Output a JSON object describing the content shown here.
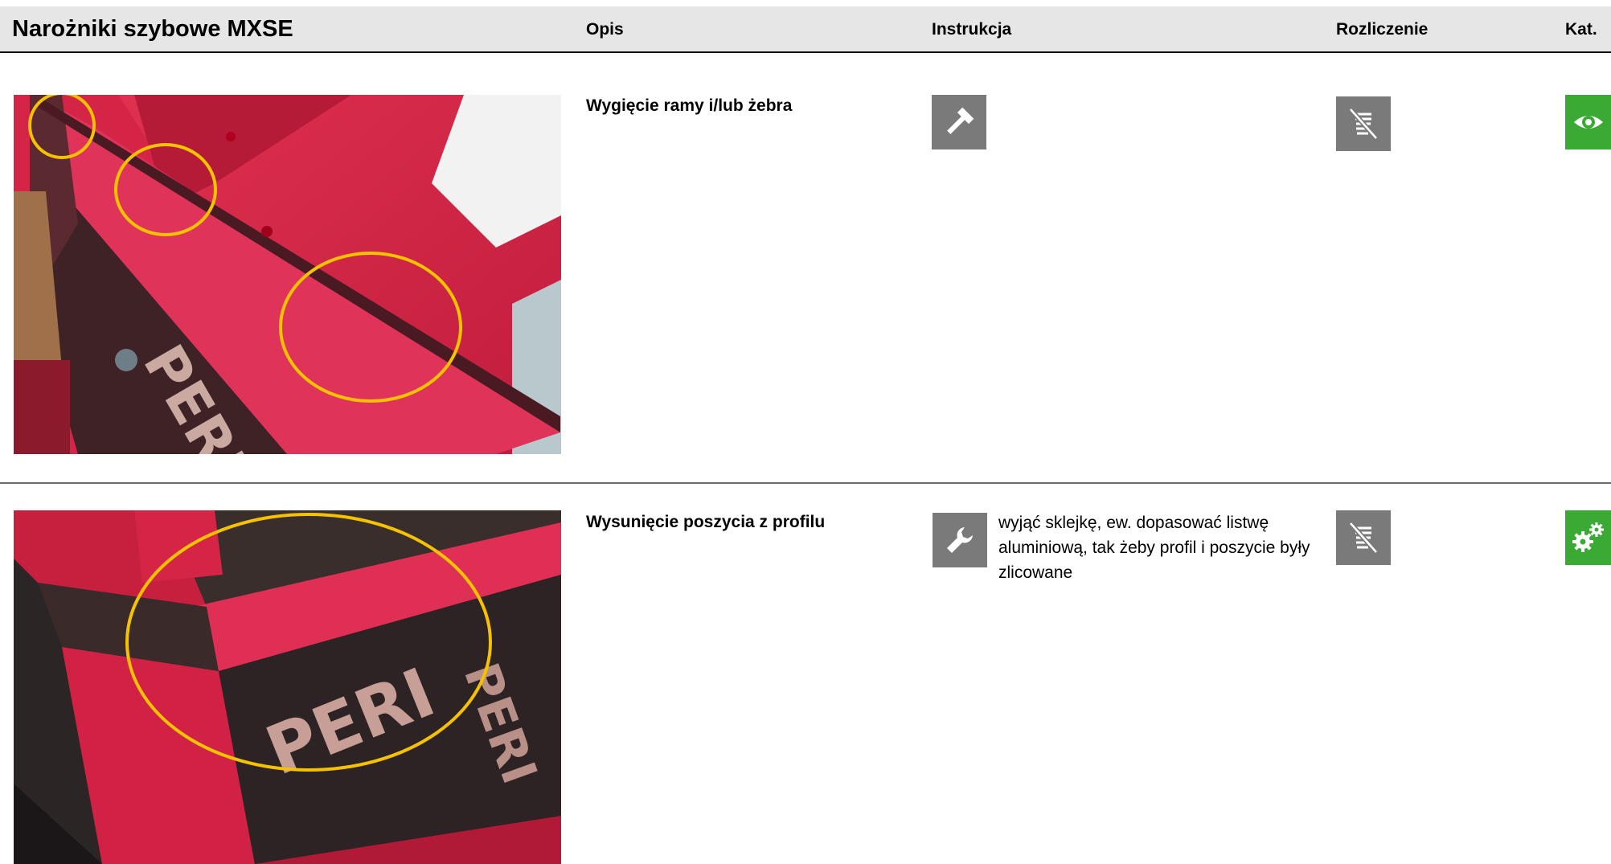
{
  "header": {
    "title": "Narożniki szybowe MXSE",
    "col_opis": "Opis",
    "col_instrukcja": "Instrukcja",
    "col_rozliczenie": "Rozliczenie",
    "col_kat": "Kat."
  },
  "rows": [
    {
      "description": "Wygięcie ramy i/lub żebra",
      "instruction_icon": "hammer-icon",
      "instruction_text": "",
      "billing_icon": "crossed-out-coins-icon",
      "category_icon": "eye-icon",
      "category_color": "#3aaa35"
    },
    {
      "description": "Wysunięcie poszycia z profilu",
      "instruction_icon": "wrench-icon",
      "instruction_text": "wyjąć sklejkę, ew. dopasować listwę aluminiową, tak żeby profil i poszycie były zlicowane",
      "billing_icon": "crossed-out-coins-icon",
      "category_icon": "gears-icon",
      "category_color": "#3aaa35"
    }
  ],
  "colors": {
    "header_bg": "#e6e6e6",
    "icon_gray": "#7a7a7a",
    "category_green": "#3aaa35",
    "highlight_circle": "#f5c200"
  }
}
